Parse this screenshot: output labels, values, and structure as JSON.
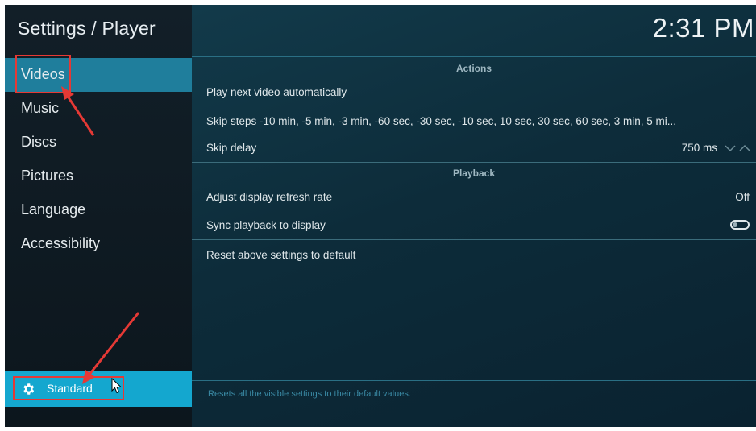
{
  "window": {
    "title": "Settings / Player",
    "clock": "2:31 PM"
  },
  "sidebar": {
    "items": [
      {
        "label": "Videos",
        "active": true
      },
      {
        "label": "Music"
      },
      {
        "label": "Discs"
      },
      {
        "label": "Pictures"
      },
      {
        "label": "Language"
      },
      {
        "label": "Accessibility"
      }
    ],
    "settings_level": {
      "label": "Standard",
      "icon": "gear-icon"
    }
  },
  "main": {
    "sections": [
      {
        "header": "Actions",
        "rows": [
          {
            "label": "Play next video automatically",
            "value": ""
          },
          {
            "label": "Skip steps  -10 min, -5 min, -3 min, -60 sec, -30 sec, -10 sec, 10 sec, 30 sec, 60 sec, 3 min, 5 mi...",
            "value": ""
          },
          {
            "label": "Skip delay",
            "value": "750 ms",
            "control": "spinner"
          }
        ]
      },
      {
        "header": "Playback",
        "rows": [
          {
            "label": "Adjust display refresh rate",
            "value": "Off"
          },
          {
            "label": "Sync playback to display",
            "value": "",
            "control": "toggle",
            "state": false
          }
        ]
      }
    ],
    "reset_label": "Reset above settings to default",
    "footer_description": "Resets all the visible settings to their default values."
  },
  "colors": {
    "accent": "#14a7cf",
    "active_item": "#1f7e9c",
    "annotation": "#e53935"
  }
}
